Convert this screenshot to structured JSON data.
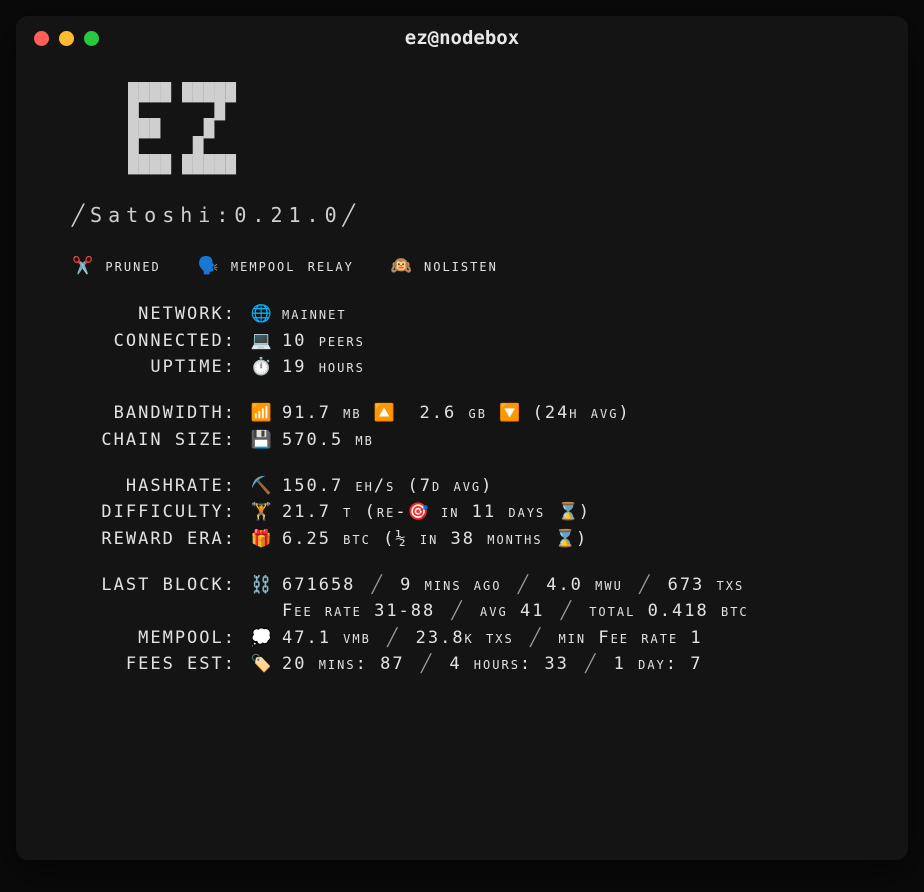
{
  "window": {
    "title": "ez@nodebox"
  },
  "logo_ascii": "████ █████\n█       █\n███    █\n█     █\n████ █████",
  "version_line": "╱Satoshi:0.21.0╱",
  "flags": {
    "pruned": {
      "icon": "✂️",
      "label": "pruned"
    },
    "mempool": {
      "icon": "🗣️",
      "label": "mempool relay"
    },
    "nolisten": {
      "icon": "🙉",
      "label": "nolisten"
    }
  },
  "network": {
    "label": "NETWORK:",
    "icon": "🌐",
    "value": "mainnet",
    "connected_label": "CONNECTED:",
    "connected_icon": "💻",
    "connected_value": "10 peers",
    "uptime_label": "UPTIME:",
    "uptime_icon": "⏱️",
    "uptime_value": "19 hours"
  },
  "bandwidth": {
    "label": "BANDWIDTH:",
    "icon": "📶",
    "up": "91.7 mb",
    "up_icon": "🔼",
    "down": "2.6 gb",
    "down_icon": "🔽",
    "suffix": "(24h avg)"
  },
  "chainsize": {
    "label": "CHAIN SIZE:",
    "icon": "💾",
    "value": "570.5 mb"
  },
  "hashrate": {
    "label": "HASHRATE:",
    "icon": "⛏️",
    "value": "150.7 eh/s (7d avg)"
  },
  "difficulty": {
    "label": "DIFFICULTY:",
    "icon": "🏋️",
    "value": "21.7 t",
    "retarget_prefix": "(re-",
    "retarget_icon": "🎯",
    "retarget_rest": " in 11 days ",
    "hourglass": "⌛",
    "close": ")"
  },
  "reward": {
    "label": "REWARD ERA:",
    "icon": "🎁",
    "value": "6.25 btc",
    "half_prefix": "(",
    "half": "½",
    "half_rest": " in 38 months ",
    "hourglass": "⌛",
    "close": ")"
  },
  "lastblock": {
    "label": "LAST BLOCK:",
    "icon": "⛓️",
    "height": "671658",
    "age": "9 mins ago",
    "weight": "4.0 mwu",
    "txs": "673 txs",
    "feerate_label": "Fee rate",
    "feerate_range": "31-88",
    "avg_label": "avg",
    "avg": "41",
    "total_label": "total",
    "total": "0.418 btc"
  },
  "mempool": {
    "label": "MEMPOOL:",
    "icon": "💭",
    "size": "47.1 vmb",
    "txs": "23.8k txs",
    "minfee_label": "min Fee rate",
    "minfee": "1"
  },
  "feesest": {
    "label": "FEES EST:",
    "icon": "🏷️",
    "t1_label": "20 mins:",
    "t1": "87",
    "t2_label": "4 hours:",
    "t2": "33",
    "t3_label": "1 day:",
    "t3": "7"
  }
}
